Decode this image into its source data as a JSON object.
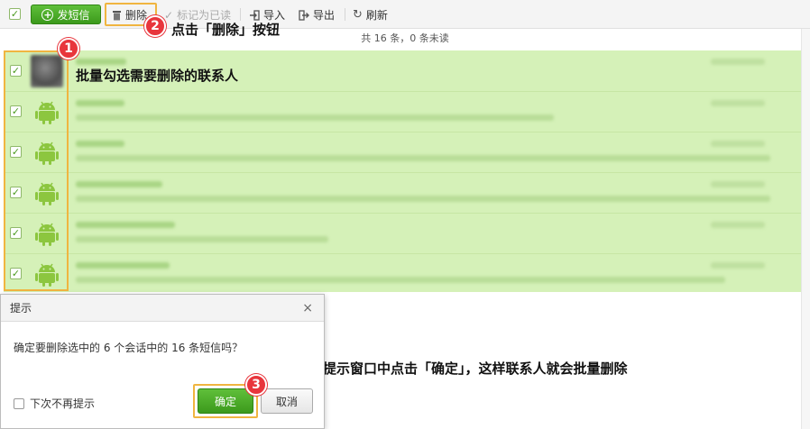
{
  "toolbar": {
    "send_label": "发短信",
    "delete_label": "删除",
    "mark_read_label": "标记为已读",
    "import_label": "导入",
    "export_label": "导出",
    "refresh_label": "刷新"
  },
  "count_text": "共 16 条，0 条未读",
  "rows": [
    {
      "avatar": "photo",
      "checked": true
    },
    {
      "avatar": "android-icon",
      "checked": true
    },
    {
      "avatar": "android-icon",
      "checked": true
    },
    {
      "avatar": "android-icon",
      "checked": true
    },
    {
      "avatar": "android-icon",
      "checked": true
    },
    {
      "avatar": "android-icon",
      "checked": true
    }
  ],
  "annotations": {
    "step1_number": "1",
    "step1_text": "批量勾选需要删除的联系人",
    "step2_number": "2",
    "step2_text": "点击「删除」按钮",
    "step3_number": "3",
    "step3_text": "在弹出的提示窗口中点击「确定」，这样联系人就会批量删除"
  },
  "dialog": {
    "title": "提示",
    "close": "×",
    "message": "确定要删除选中的 6 个会话中的 16 条短信吗？",
    "checkbox_label": "下次不再提示",
    "ok_label": "确定",
    "cancel_label": "取消"
  },
  "colors": {
    "accent_green": "#3c9a1c",
    "row_selected": "#d5f1b8",
    "highlight_border": "#f0b540",
    "badge_red": "#e8353c"
  }
}
